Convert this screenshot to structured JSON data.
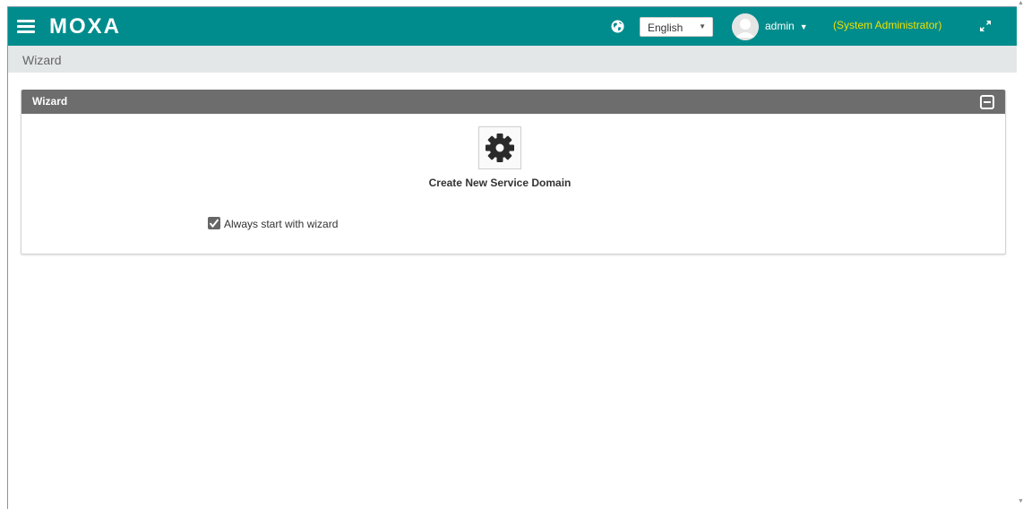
{
  "app": {
    "brand": "MOXA"
  },
  "header": {
    "language": "English",
    "user": "admin",
    "role": "(System Administrator)"
  },
  "breadcrumb": "Wizard",
  "panel": {
    "title": "Wizard",
    "tile_label": "Create New Service Domain",
    "checkbox_label": "Always start with wizard",
    "checkbox_checked": true
  },
  "icons": {
    "menu": "hamburger-menu-icon",
    "language": "globe-icon",
    "user": "avatar-icon",
    "fullscreen": "expand-icon",
    "collapse": "collapse-icon",
    "wizard_tile": "gear-icon",
    "checkbox": "checkmark-icon"
  },
  "colors": {
    "header_bg": "#008c8c",
    "role_text": "#f0e100",
    "breadcrumb_bg": "#e4e7e7",
    "panel_header_bg": "#6d6d6d"
  }
}
